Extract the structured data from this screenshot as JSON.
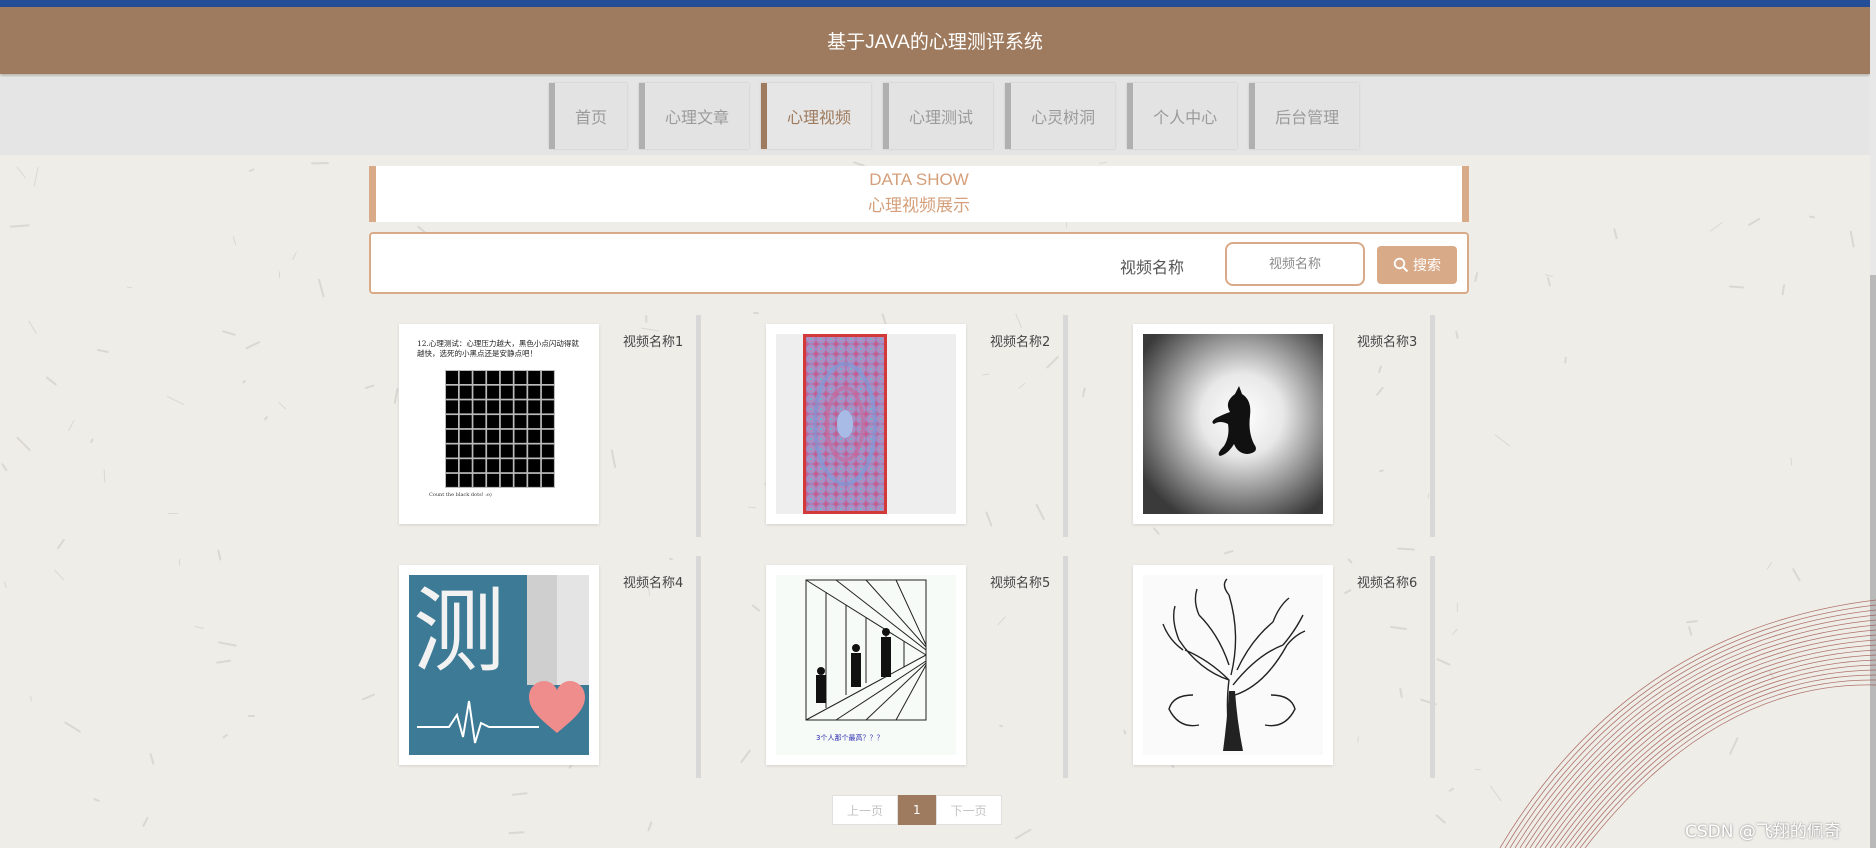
{
  "header": {
    "title": "基于JAVA的心理测评系统"
  },
  "nav": {
    "items": [
      {
        "label": "首页",
        "active": false
      },
      {
        "label": "心理文章",
        "active": false
      },
      {
        "label": "心理视频",
        "active": true
      },
      {
        "label": "心理测试",
        "active": false
      },
      {
        "label": "心灵树洞",
        "active": false
      },
      {
        "label": "个人中心",
        "active": false
      },
      {
        "label": "后台管理",
        "active": false
      }
    ]
  },
  "showcase": {
    "title_en": "DATA SHOW",
    "title_cn": "心理视频展示"
  },
  "search": {
    "label": "视频名称",
    "placeholder": "视频名称",
    "button_label": "搜索",
    "button_icon": "search-icon"
  },
  "videos": [
    {
      "name": "视频名称1",
      "thumb_text_top": "12.心理测试：心理压力越大，黑色小点闪动得就越快，选死的小黑点还是安静点吧！",
      "thumb_text_bottom": "Count the black dots! :o)"
    },
    {
      "name": "视频名称2"
    },
    {
      "name": "视频名称3"
    },
    {
      "name": "视频名称4",
      "thumb_text": "测"
    },
    {
      "name": "视频名称5",
      "thumb_text": "3个人那个最高？？？"
    },
    {
      "name": "视频名称6"
    }
  ],
  "pagination": {
    "prev": "上一页",
    "current": "1",
    "next": "下一页"
  },
  "watermark": "CSDN @飞翔的佩奇",
  "colors": {
    "accent": "#9e7b5e",
    "topbar": "#234d97",
    "highlight": "#d9aa88"
  }
}
